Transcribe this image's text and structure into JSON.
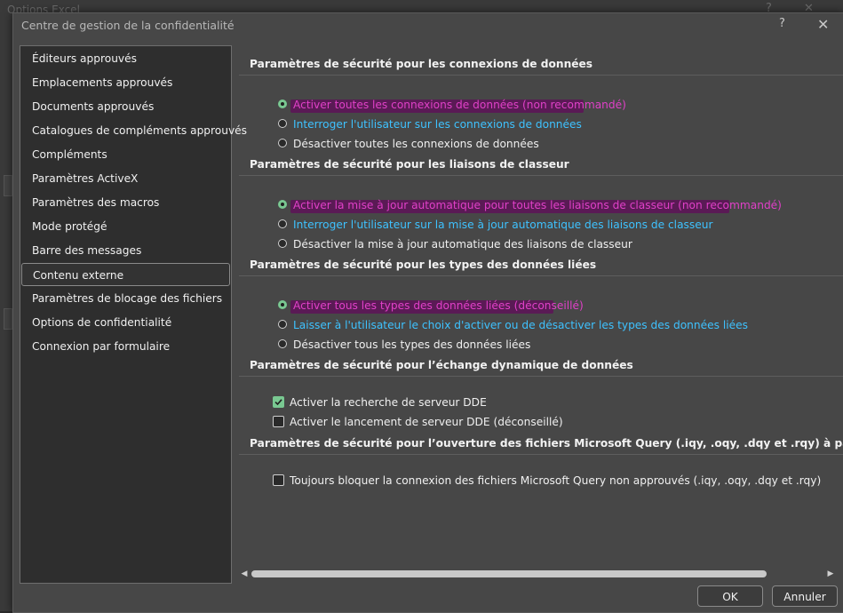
{
  "background_window": {
    "title": "Options Excel",
    "help": "?",
    "close": "✕"
  },
  "dialog": {
    "title": "Centre de gestion de la confidentialité",
    "help": "?",
    "close": "✕"
  },
  "sidebar": {
    "selected_index": 9,
    "items": [
      {
        "label": "Éditeurs approuvés"
      },
      {
        "label": "Emplacements approuvés"
      },
      {
        "label": "Documents approuvés"
      },
      {
        "label": "Catalogues de compléments approuvés"
      },
      {
        "label": "Compléments"
      },
      {
        "label": "Paramètres ActiveX"
      },
      {
        "label": "Paramètres des macros"
      },
      {
        "label": "Mode protégé"
      },
      {
        "label": "Barre des messages"
      },
      {
        "label": "Contenu externe"
      },
      {
        "label": "Paramètres de blocage des fichiers"
      },
      {
        "label": "Options de confidentialité"
      },
      {
        "label": "Connexion par formulaire"
      }
    ]
  },
  "sections": {
    "data_connections": {
      "heading": "Paramètres de sécurité pour les connexions de données",
      "options": [
        {
          "label": "Activer toutes les connexions de données (non recommandé)",
          "checked": true
        },
        {
          "label": "Interroger l'utilisateur sur les connexions de données",
          "checked": false
        },
        {
          "label": "Désactiver toutes les connexions de données",
          "checked": false
        }
      ]
    },
    "workbook_links": {
      "heading": "Paramètres de sécurité pour les liaisons de classeur",
      "options": [
        {
          "label": "Activer la mise à jour automatique pour toutes les liaisons de classeur (non recommandé)",
          "checked": true
        },
        {
          "label": "Interroger l'utilisateur sur la mise à jour automatique des liaisons de classeur",
          "checked": false
        },
        {
          "label": "Désactiver la mise à jour automatique des liaisons de classeur",
          "checked": false
        }
      ]
    },
    "linked_data_types": {
      "heading": "Paramètres de sécurité pour les types des données liées",
      "options": [
        {
          "label": "Activer tous les types des données liées (déconseillé)",
          "checked": true
        },
        {
          "label": "Laisser à l'utilisateur le choix d'activer ou de désactiver les types des données liées",
          "checked": false
        },
        {
          "label": "Désactiver tous les types des données liées",
          "checked": false
        }
      ]
    },
    "dde": {
      "heading": "Paramètres de sécurité pour l’échange dynamique de données",
      "options": [
        {
          "label": "Activer la recherche de serveur DDE",
          "checked": true
        },
        {
          "label": "Activer le lancement de serveur DDE (déconseillé)",
          "checked": false
        }
      ]
    },
    "ms_query": {
      "heading": "Paramètres de sécurité pour l’ouverture des fichiers Microsoft Query (.iqy, .oqy, .dqy et .rqy) à partir d’une source non ap",
      "options": [
        {
          "label": "Toujours bloquer la connexion des fichiers Microsoft Query non approuvés (.iqy, .oqy, .dqy et .rqy)",
          "checked": false
        }
      ]
    }
  },
  "scrollbar": {
    "left_arrow": "◀",
    "right_arrow": "▶"
  },
  "buttons": {
    "ok": "OK",
    "cancel": "Annuler"
  },
  "colors": {
    "link_blue": "#3ec2ff",
    "highlight_magenta": "#e040c8",
    "check_green": "#79c891",
    "dialog_bg": "#474747",
    "sidebar_bg": "#2e2e2e"
  }
}
